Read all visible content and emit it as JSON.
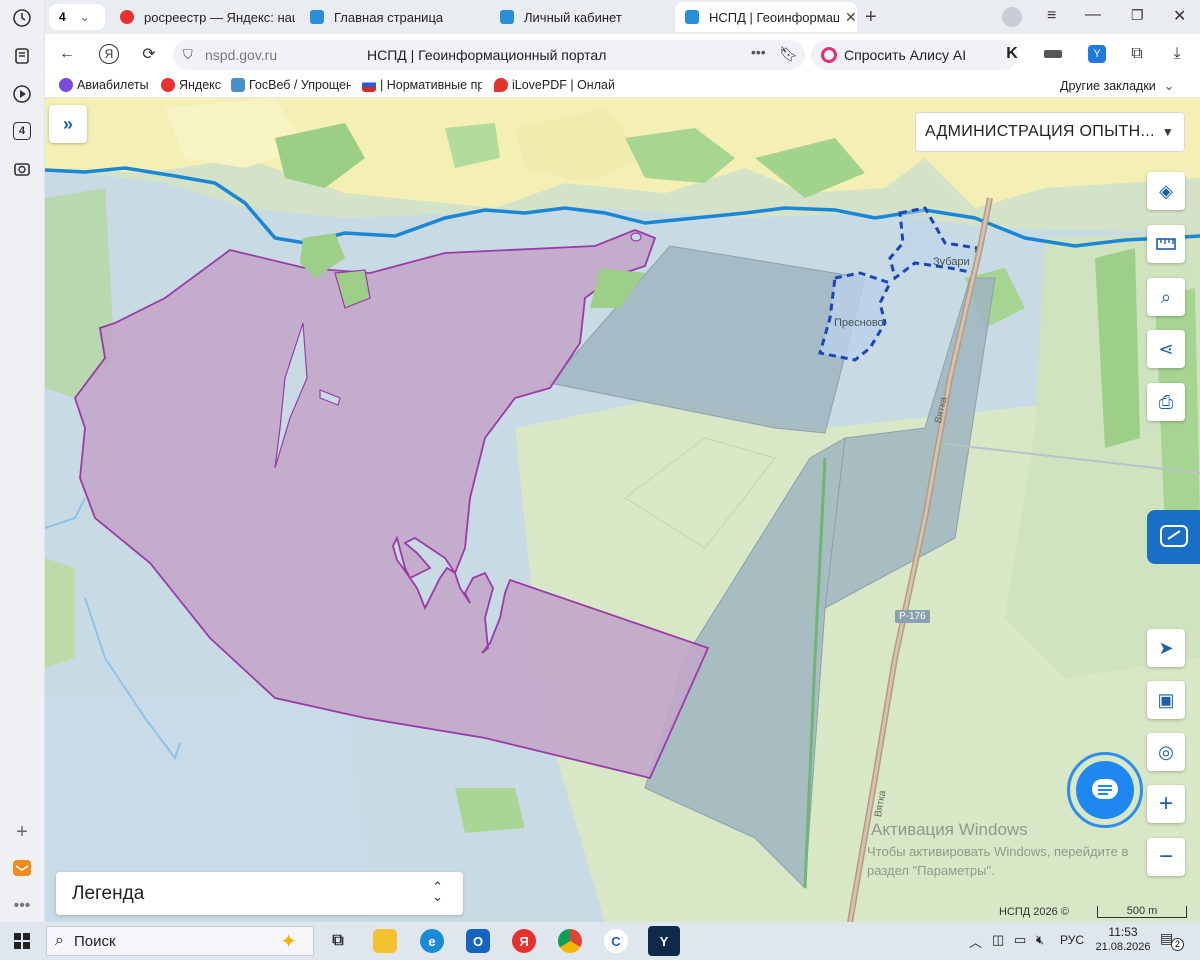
{
  "sidebar": {
    "tab_count_badge": "4"
  },
  "tabs": [
    {
      "label": "росреестр — Яндекс: наш",
      "favicon_color": "#e8312f"
    },
    {
      "label": "Главная страница",
      "favicon_color": "#2a8fd4"
    },
    {
      "label": "Личный кабинет",
      "favicon_color": "#2a8fd4"
    },
    {
      "label": "НСПД | Геоинформаци",
      "favicon_color": "#2a8fd4",
      "active": true
    }
  ],
  "tab_group_count": "4",
  "address": {
    "domain": "nspd.gov.ru",
    "page_title": "НСПД | Геоинформационный портал",
    "alice_label": "Спросить Алису AI"
  },
  "bookmarks": [
    {
      "label": "Авиабилеты"
    },
    {
      "label": "Яндекс"
    },
    {
      "label": "ГосВеб / Упрощен"
    },
    {
      "label": "| Нормативные пр"
    },
    {
      "label": "iLovePDF | Онлай"
    }
  ],
  "bookmarks_other": "Другие закладки",
  "map": {
    "admin_select_value": "АДМИНИСТРАЦИЯ ОПЫТН...",
    "place_labels": [
      "Зубари",
      "Пресново"
    ],
    "road_labels": [
      "Вятка",
      "Вятка"
    ],
    "road_shield": "Р-176",
    "copyright": "НСПД 2026 ©",
    "scale_label": "500 m",
    "legend_label": "Легенда",
    "watermark_title": "Активация Windows",
    "watermark_line1": "Чтобы активировать Windows, перейдите в",
    "watermark_line2": "раздел \"Параметры\"."
  },
  "taskbar": {
    "search_placeholder": "Поиск",
    "lang": "РУС",
    "time": "11:53",
    "date": "21.08.2026",
    "notification_count": "2"
  }
}
